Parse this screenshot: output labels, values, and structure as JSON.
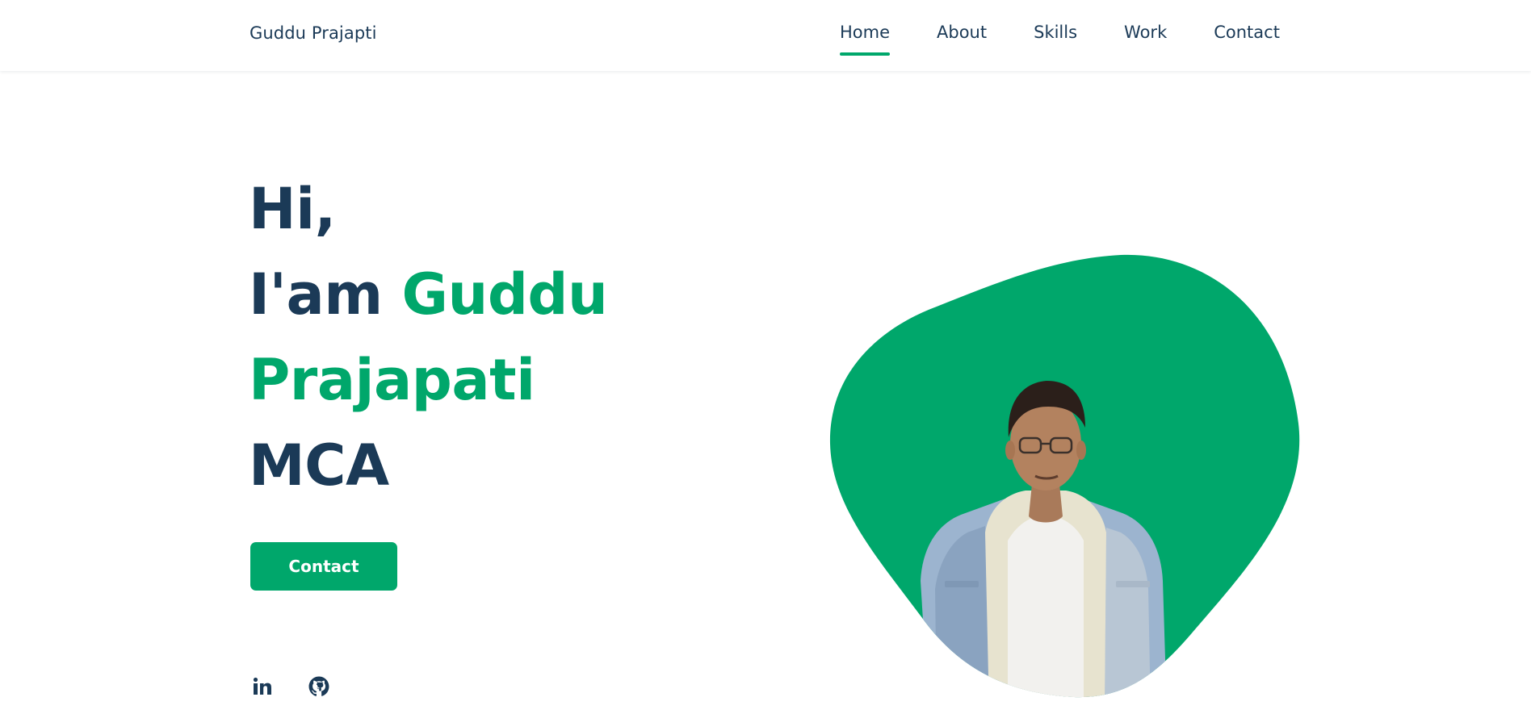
{
  "header": {
    "logo": "Guddu Prajapti",
    "nav": [
      {
        "label": "Home",
        "active": true
      },
      {
        "label": "About",
        "active": false
      },
      {
        "label": "Skills",
        "active": false
      },
      {
        "label": "Work",
        "active": false
      },
      {
        "label": "Contact",
        "active": false
      }
    ]
  },
  "hero": {
    "greeting": "Hi,",
    "intro": "I'am",
    "first_name": "Guddu",
    "last_name": "Prajapati",
    "degree": "MCA",
    "button_label": "Contact",
    "socials": [
      {
        "name": "linkedin-icon"
      },
      {
        "name": "github-icon"
      }
    ]
  },
  "colors": {
    "accent": "#00a76b",
    "text": "#1b3a57",
    "background": "#ffffff"
  }
}
